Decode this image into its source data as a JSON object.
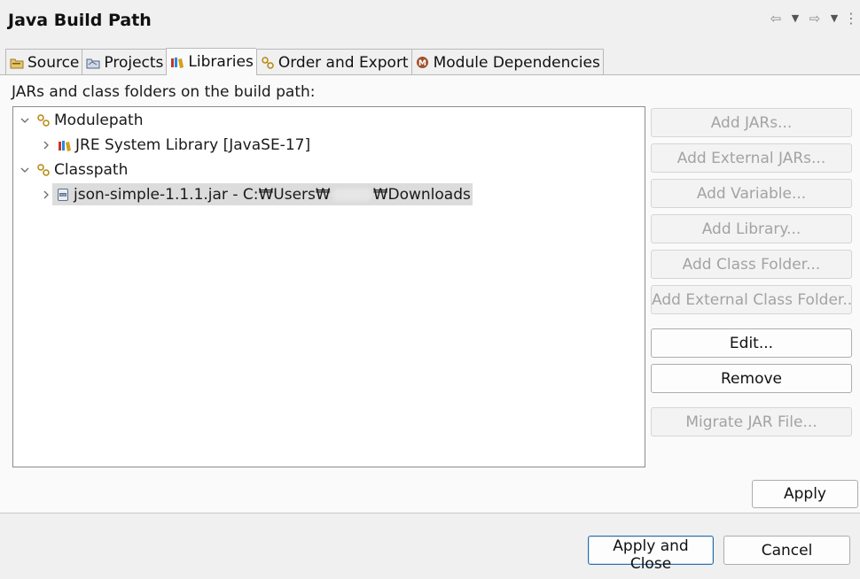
{
  "window": {
    "title": "Java Build Path"
  },
  "header_icons": [
    "back-arrow-icon",
    "dropdown-icon",
    "forward-arrow-icon",
    "dropdown-icon",
    "more-vert-icon"
  ],
  "tabs": [
    {
      "label": "Source",
      "icon": "source-folder-icon",
      "mnemonic": "S",
      "active": false
    },
    {
      "label": "Projects",
      "icon": "projects-icon",
      "mnemonic": "P",
      "active": false
    },
    {
      "label": "Libraries",
      "icon": "libraries-icon",
      "mnemonic": "L",
      "active": true
    },
    {
      "label": "Order and Export",
      "icon": "order-export-icon",
      "mnemonic": "O",
      "active": false
    },
    {
      "label": "Module Dependencies",
      "icon": "module-icon",
      "mnemonic": "M",
      "active": false
    }
  ],
  "libraries": {
    "section_label": "JARs and class folders on the build path:",
    "tree": [
      {
        "label": "Modulepath",
        "level": 0,
        "expanded": true,
        "icon": "classpath-container-icon"
      },
      {
        "label": "JRE System Library [JavaSE-17]",
        "level": 1,
        "expanded": false,
        "icon": "jre-library-icon"
      },
      {
        "label": "Classpath",
        "level": 0,
        "expanded": true,
        "icon": "classpath-container-icon"
      },
      {
        "label_start": "json-simple-1.1.1.jar - C:₩Users₩",
        "label_end": "₩Downloads",
        "level": 1,
        "expanded": false,
        "icon": "jar-file-icon",
        "selected": true
      }
    ]
  },
  "buttons": {
    "add_jars": "Add JARs...",
    "add_external_jars": "Add External JARs...",
    "add_variable": "Add Variable...",
    "add_library": "Add Library...",
    "add_class_folder": "Add Class Folder...",
    "add_external_class_folder": "Add External Class Folder...",
    "edit": "Edit...",
    "remove": "Remove",
    "migrate_jar": "Migrate JAR File...",
    "apply": "Apply"
  },
  "footer": {
    "apply_and_close": "Apply and Close",
    "cancel": "Cancel"
  },
  "colors": {
    "selection": "#dcdcdc",
    "default_button_border": "#2b6cb0",
    "disabled_text": "#a3a3a3"
  }
}
